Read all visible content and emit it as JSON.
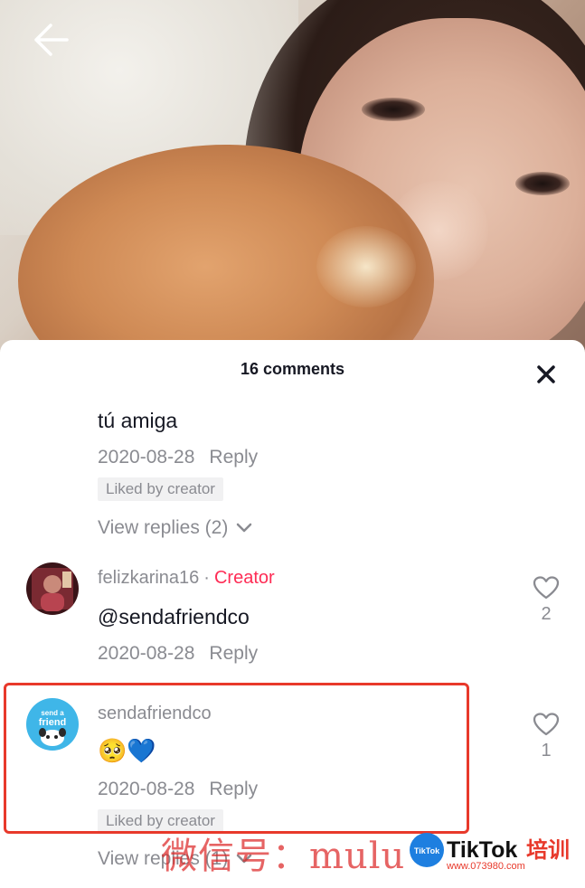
{
  "header": {
    "comments_title": "16 comments"
  },
  "comments": [
    {
      "text": "tú amiga",
      "date": "2020-08-28",
      "reply_label": "Reply",
      "badge": "Liked by creator",
      "view_replies": "View replies (2)"
    },
    {
      "username": "felizkarina16",
      "separator": "·",
      "role": "Creator",
      "text": "@sendafriendco",
      "date": "2020-08-28",
      "reply_label": "Reply",
      "likes": "2"
    },
    {
      "username": "sendafriendco",
      "avatar_text_1": "send a",
      "avatar_text_2": "friend",
      "text": "🥺💙",
      "date": "2020-08-28",
      "reply_label": "Reply",
      "badge": "Liked by creator",
      "likes": "1",
      "view_replies": "View replies (1)"
    }
  ],
  "watermark": {
    "text": "微信号：mulu",
    "logo_icon_text": "TikTok",
    "logo_text": "TikTok",
    "logo_suffix": "培训",
    "logo_url": "www.073980.com"
  },
  "colors": {
    "accent_creator": "#fe2c55",
    "highlight_border": "#e8392b",
    "muted_text": "#8a8b91",
    "primary_text": "#161823"
  },
  "icons": {
    "back": "back-arrow-icon",
    "close": "close-icon",
    "like": "heart-outline-icon",
    "expand": "chevron-down-icon"
  }
}
